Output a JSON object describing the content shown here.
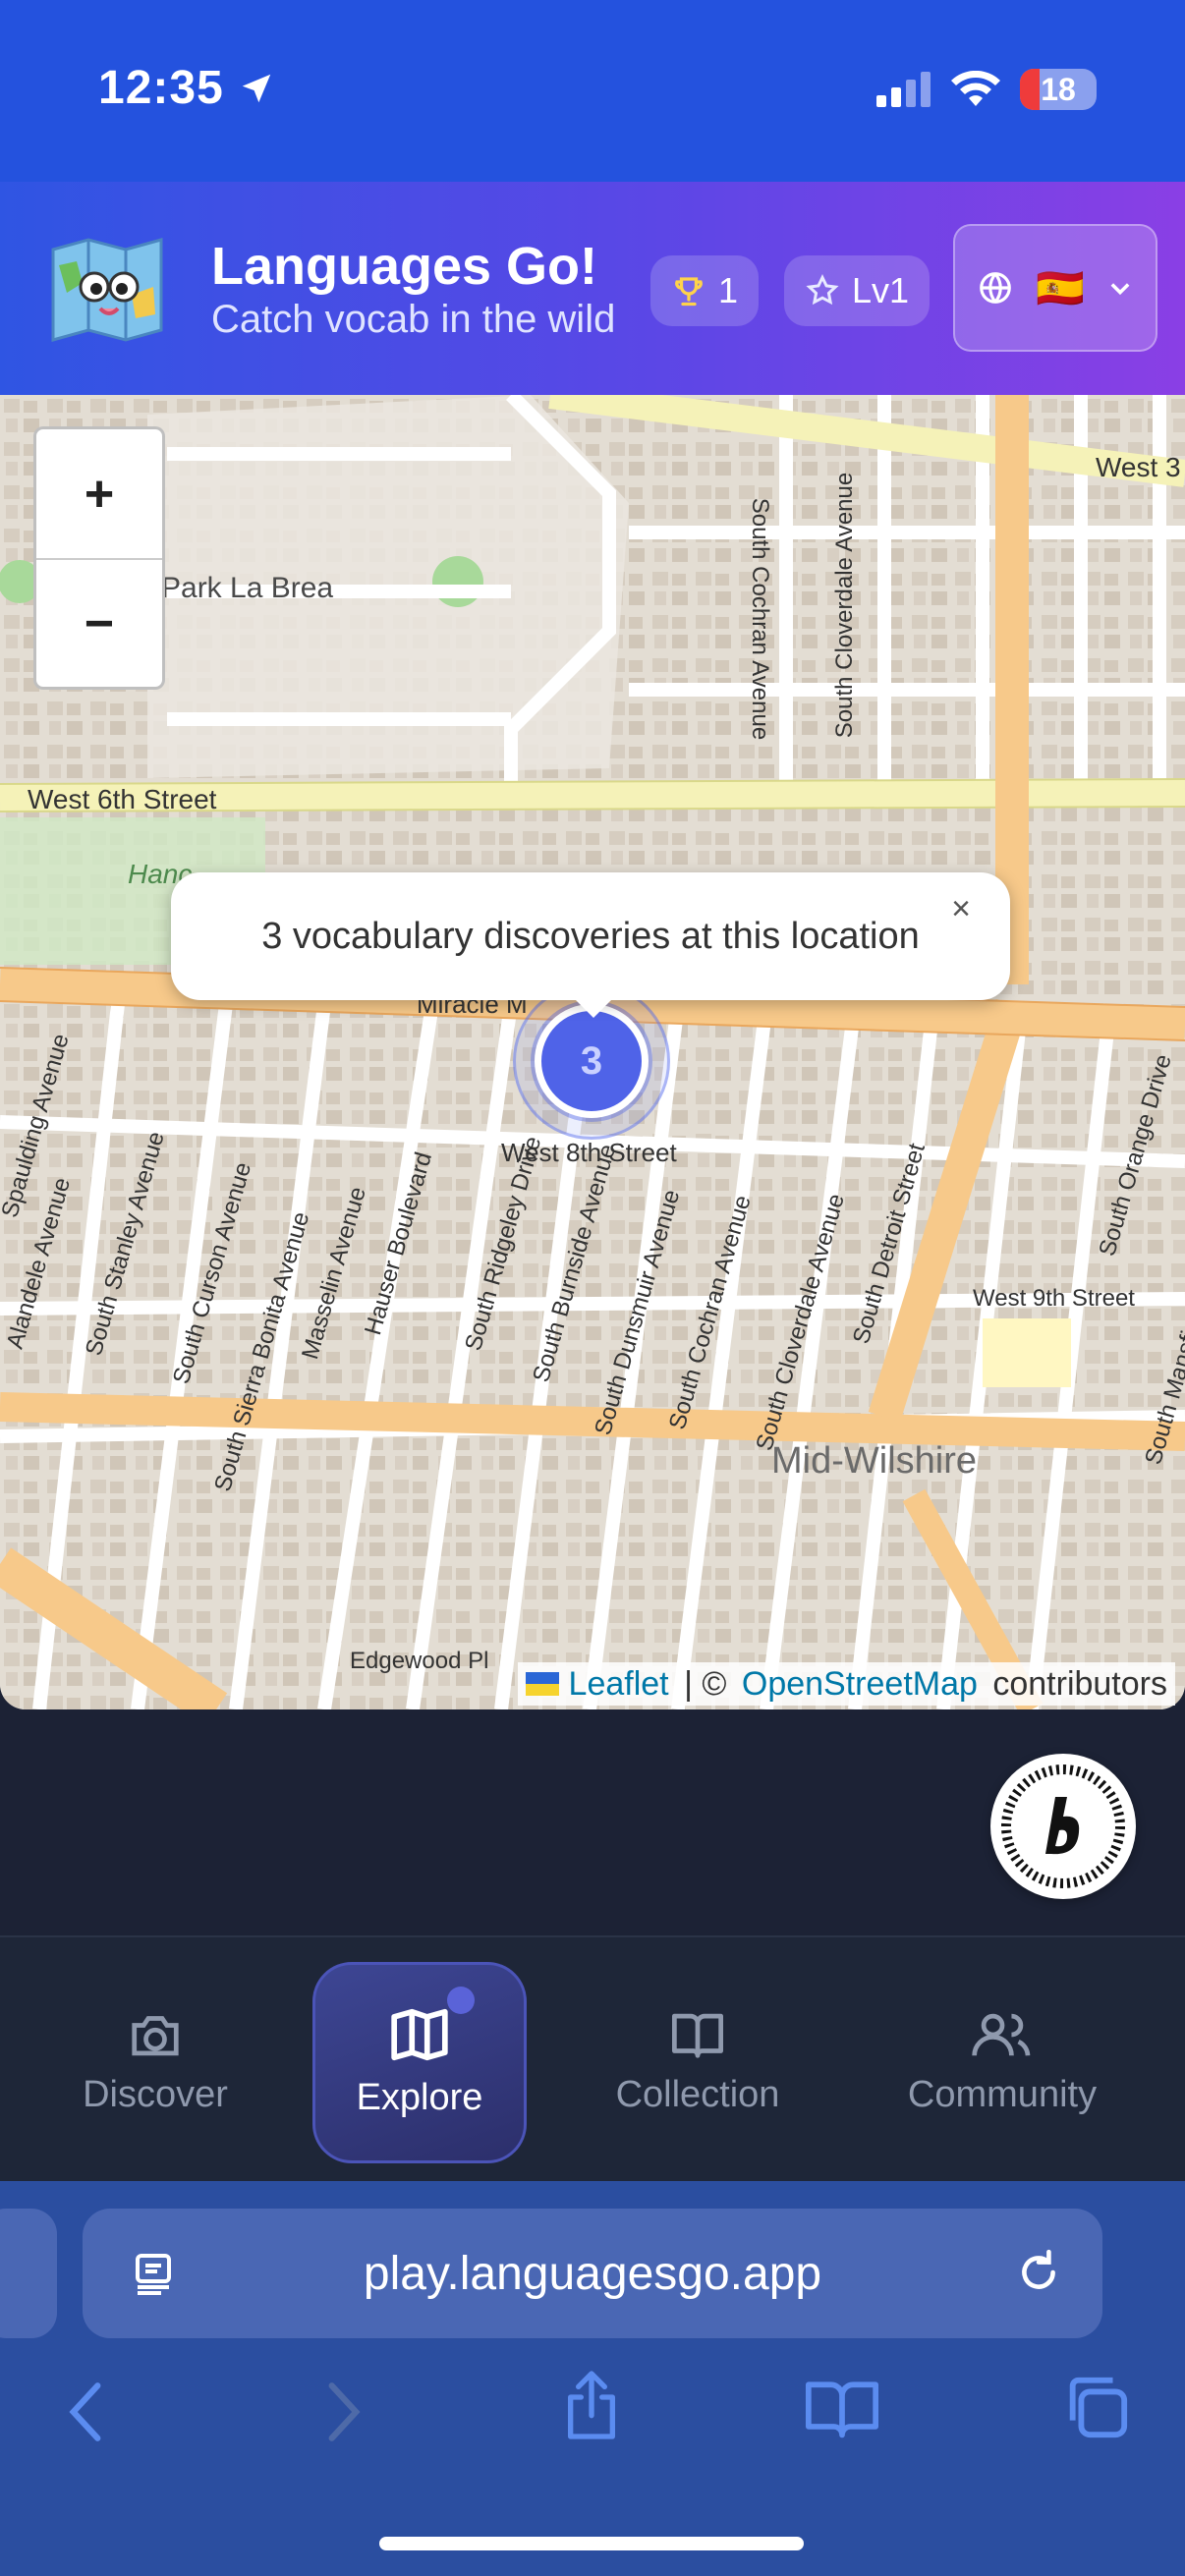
{
  "status_bar": {
    "time": "12:35",
    "battery": "18"
  },
  "header": {
    "title": "Languages Go!",
    "subtitle": "Catch vocab in the wild",
    "trophy_count": "1",
    "level": "Lv1",
    "language_flag": "🇪🇸"
  },
  "map": {
    "zoom_in": "+",
    "zoom_out": "−",
    "labels": {
      "park": "Park La Brea",
      "w6": "West 6th Street",
      "w8": "West 8th Street",
      "w9": "West 9th Street",
      "w3": "West 3",
      "district": "Mid-Wilshire",
      "miracle": "Miracle M",
      "edgewood": "Edgewood Pl",
      "cochran": "South Cochran Avenue",
      "cloverdale": "South Cloverdale Avenue",
      "hauser": "Hauser Boulevard",
      "ridgeley": "South Ridgeley Drive",
      "burnside": "South Burnside Avenue",
      "dunsmuir": "South Dunsmuir Avenue",
      "cochran2": "South Cochran Avenue",
      "cloverdale2": "South Cloverdale Avenue",
      "detroit": "South Detroit Street",
      "stanley": "South Stanley Avenue",
      "curson": "South Curson Avenue",
      "sierra": "South Sierra Bonita Avenue",
      "masselin": "Masselin Avenue",
      "orange": "South Orange Drive",
      "mansfield": "South Mansfield Avenue",
      "alandele": "Alandele Avenue",
      "fairfax": "Spaulding Avenue",
      "hancock": "Hanc"
    },
    "popup_text": "3 vocabulary discoveries at this location",
    "popup_close": "×",
    "cluster_count": "3",
    "attribution": {
      "leaflet": "Leaflet",
      "separator": " | © ",
      "osm": "OpenStreetMap",
      "suffix": " contributors"
    }
  },
  "nav": {
    "items": [
      {
        "label": "Discover",
        "icon": "camera-icon",
        "active": false
      },
      {
        "label": "Explore",
        "icon": "map-icon",
        "active": true
      },
      {
        "label": "Collection",
        "icon": "book-icon",
        "active": false
      },
      {
        "label": "Community",
        "icon": "users-icon",
        "active": false
      }
    ]
  },
  "browser": {
    "url": "play.languagesgo.app"
  },
  "colors": {
    "status_bar": "#2452de",
    "accent": "#4f63e8",
    "nav_bg": "#1e2638",
    "safari_bg": "#2b4ea0"
  }
}
